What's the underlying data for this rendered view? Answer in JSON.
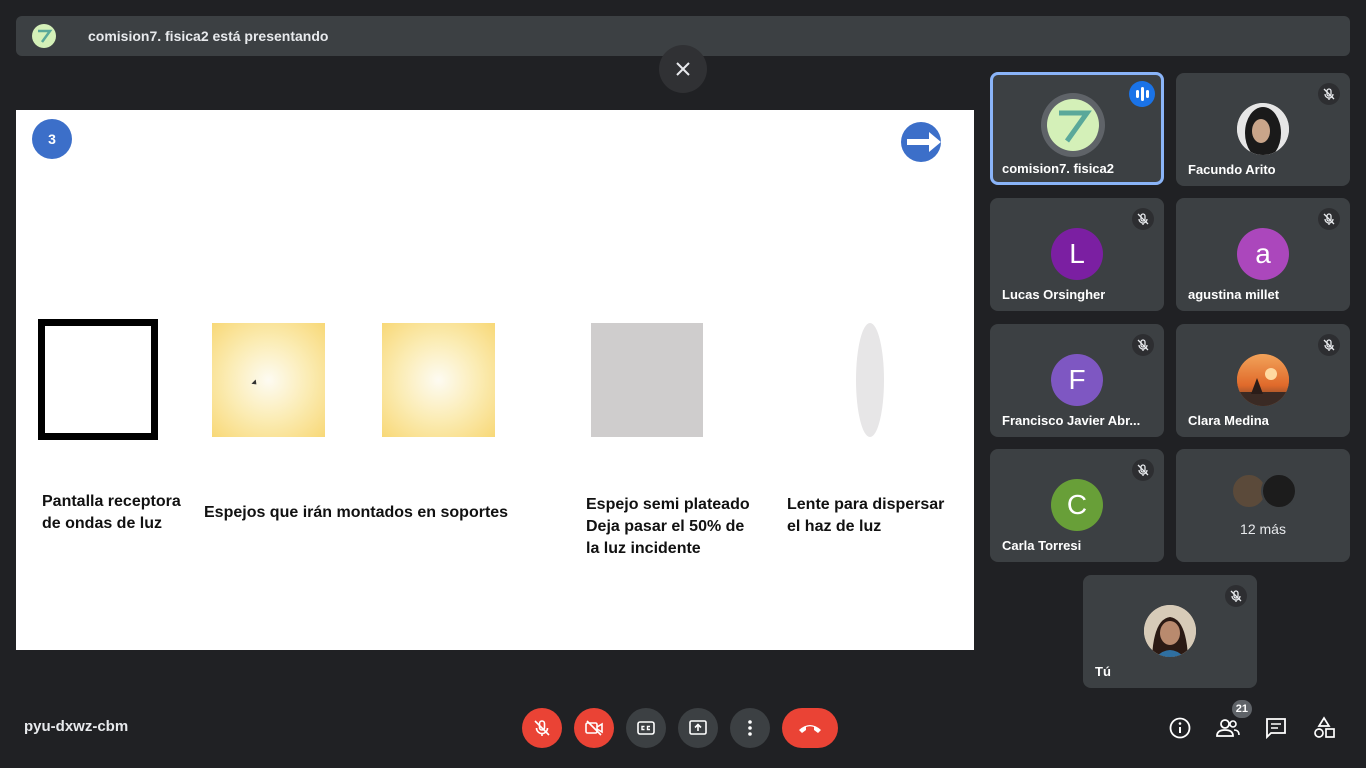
{
  "banner": {
    "text": "comision7. fisica2 está presentando"
  },
  "slide": {
    "page_number": "3",
    "labels": {
      "screen": "Pantalla receptora\nde ondas de luz",
      "mirrors": "Espejos que irán montados en soportes",
      "semi_mirror": "Espejo semi plateado\nDeja pasar el 50% de\nla luz incidente",
      "lens": "Lente para dispersar\nel haz de luz"
    }
  },
  "participants": [
    {
      "name": "comision7. fisica2",
      "avatar": "7",
      "color": "#d4f0b8",
      "speaking": true
    },
    {
      "name": "Facundo Arito",
      "avatar": "photo",
      "muted": true
    },
    {
      "name": "Lucas Orsingher",
      "avatar": "L",
      "color": "#7b1fa2",
      "muted": true
    },
    {
      "name": "agustina millet",
      "avatar": "a",
      "color": "#ab47bc",
      "muted": true
    },
    {
      "name": "Francisco Javier Abr...",
      "avatar": "F",
      "color": "#7e57c2",
      "muted": true
    },
    {
      "name": "Clara Medina",
      "avatar": "photo",
      "muted": true
    },
    {
      "name": "Carla Torresi",
      "avatar": "C",
      "color": "#689f38",
      "muted": true
    },
    {
      "name": "12 más",
      "avatar": "group"
    },
    {
      "name": "Tú",
      "avatar": "photo",
      "muted": true
    }
  ],
  "meeting": {
    "code": "pyu-dxwz-cbm"
  },
  "people": {
    "count": "21"
  },
  "colors": {
    "accent": "#8ab4f8",
    "danger": "#ea4335",
    "surface": "#3c4043",
    "background": "#202124",
    "slide_badge": "#3c6fc9"
  }
}
